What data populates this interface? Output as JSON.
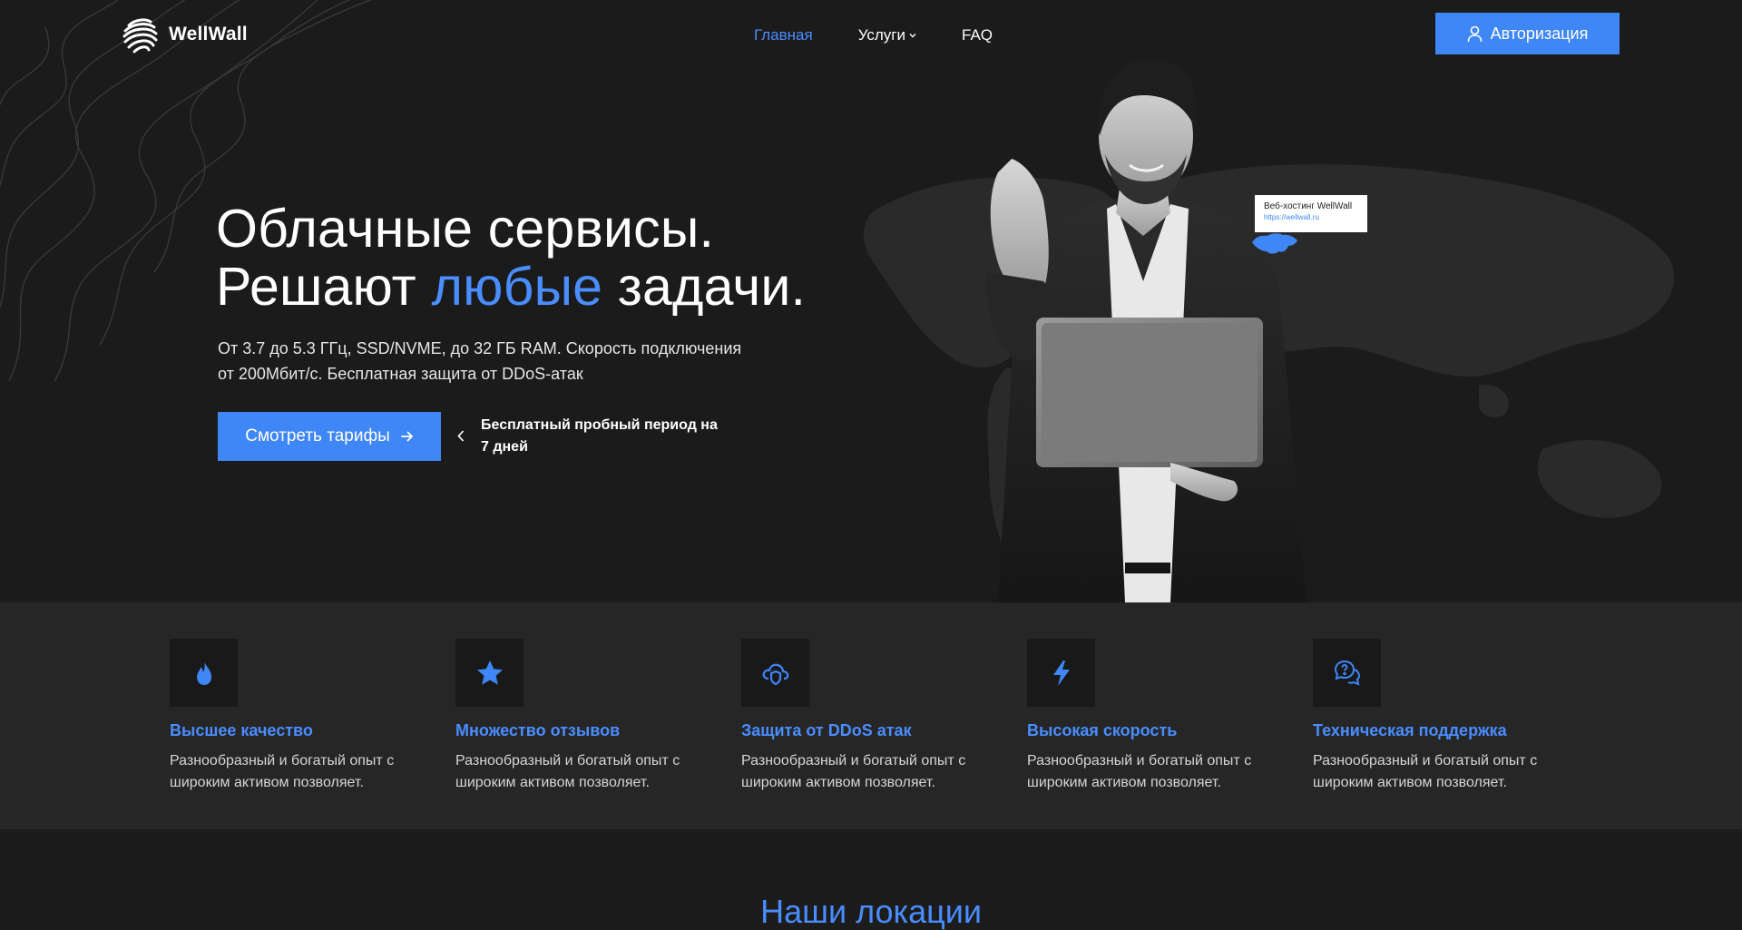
{
  "header": {
    "logo_text": "WellWall",
    "nav": [
      {
        "label": "Главная",
        "active": true
      },
      {
        "label": "Услуги",
        "dropdown": true
      },
      {
        "label": "FAQ"
      }
    ],
    "login_label": "Авторизация"
  },
  "hero": {
    "title_line1": "Облачные сервисы.",
    "title_line2_before": "Решают ",
    "title_line2_accent": "любые",
    "title_line2_after": " задачи.",
    "lead": "От 3.7 до 5.3 ГГц, SSD/NVME, до 32 ГБ RAM. Скорость подключения от 200Мбит/с. Бесплатная защита от DDoS-атак",
    "cta_label": "Смотреть тарифы",
    "trial_text": "Бесплатный пробный период на 7 дней"
  },
  "tooltip": {
    "title": "Веб-хостинг WellWall",
    "url": "https://wellwall.ru"
  },
  "features": [
    {
      "icon": "flame-icon",
      "title": "Высшее качество",
      "desc": "Разнообразный и богатый опыт с широким активом позволяет."
    },
    {
      "icon": "star-icon",
      "title": "Множество отзывов",
      "desc": "Разнообразный и богатый опыт с широким активом позволяет."
    },
    {
      "icon": "shield-cloud-icon",
      "title": "Защита от DDoS атак",
      "desc": "Разнообразный и богатый опыт с широким активом позволяет."
    },
    {
      "icon": "lightning-icon",
      "title": "Высокая скорость",
      "desc": "Разнообразный и богатый опыт с широким активом позволяет."
    },
    {
      "icon": "support-chat-icon",
      "title": "Техническая поддержка",
      "desc": "Разнообразный и богатый опыт с широким активом позволяет."
    }
  ],
  "locations_title": "Наши локации",
  "colors": {
    "accent": "#3f86f7",
    "background": "#1b1b1c",
    "features_bg": "#262627"
  }
}
